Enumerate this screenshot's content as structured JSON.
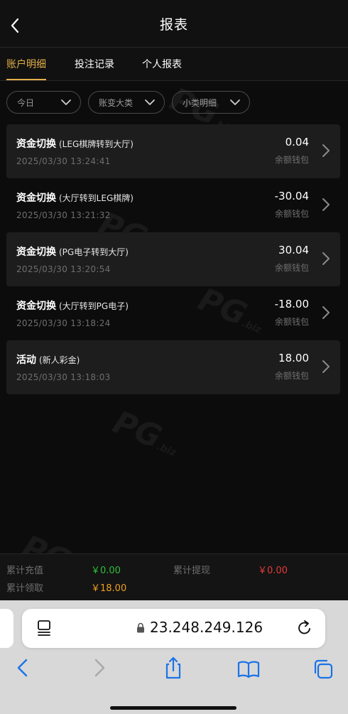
{
  "header": {
    "title": "报表"
  },
  "tabs": [
    {
      "label": "账户明细",
      "active": true
    },
    {
      "label": "投注记录",
      "active": false
    },
    {
      "label": "个人报表",
      "active": false
    }
  ],
  "filters": [
    {
      "label": "今日"
    },
    {
      "label": "账变大类"
    },
    {
      "label": "小类明细"
    }
  ],
  "records": [
    {
      "type": "资金切换",
      "detail": "(LEG棋牌转到大厅)",
      "time": "2025/03/30 13:24:41",
      "amount": "0.04",
      "wallet": "余额钱包"
    },
    {
      "type": "资金切换",
      "detail": "(大厅转到LEG棋牌)",
      "time": "2025/03/30 13:21:32",
      "amount": "-30.04",
      "wallet": "余额钱包"
    },
    {
      "type": "资金切换",
      "detail": "(PG电子转到大厅)",
      "time": "2025/03/30 13:20:54",
      "amount": "30.04",
      "wallet": "余额钱包"
    },
    {
      "type": "资金切换",
      "detail": "(大厅转到PG电子)",
      "time": "2025/03/30 13:18:24",
      "amount": "-18.00",
      "wallet": "余额钱包"
    },
    {
      "type": "活动",
      "detail": "(新人彩金)",
      "time": "2025/03/30 13:18:03",
      "amount": "18.00",
      "wallet": "余额钱包"
    }
  ],
  "summary": {
    "recharge_label": "累计充值",
    "recharge_value": "￥0.00",
    "withdraw_label": "累计提现",
    "withdraw_value": "￥0.00",
    "claim_label": "累计领取",
    "claim_value": "￥18.00"
  },
  "browser": {
    "url": "23.248.249.126"
  },
  "watermark": "PG",
  "watermark_sub": ".biz",
  "colors": {
    "accent": "#e2b04a",
    "green": "#2fbf3a",
    "red": "#e33b3b",
    "orange": "#f0a021"
  }
}
